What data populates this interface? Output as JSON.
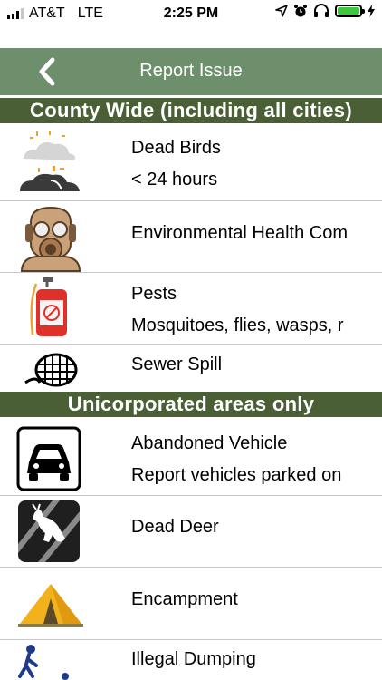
{
  "status_bar": {
    "carrier": "AT&T",
    "network": "LTE",
    "time": "2:25 PM",
    "battery_level": 1.0,
    "icons": [
      "location-icon",
      "alarm-icon",
      "headphones-icon",
      "battery-icon",
      "charging-icon"
    ]
  },
  "nav": {
    "title": "Report Issue",
    "back_icon": "chevron-left-icon",
    "bar_color": "#6e8f6b"
  },
  "sections": [
    {
      "title": "County Wide (including all cities)",
      "items": [
        {
          "title": "Dead Birds",
          "subtitle": "< 24 hours",
          "icon": "dead-birds-icon"
        },
        {
          "title": "Environmental Health Com",
          "subtitle": "",
          "icon": "gas-mask-icon"
        },
        {
          "title": "Pests",
          "subtitle": "Mosquitoes, flies, wasps, r",
          "icon": "sprayer-icon"
        },
        {
          "title": "Sewer Spill",
          "subtitle": "",
          "icon": "sewer-grate-icon"
        }
      ]
    },
    {
      "title": "Unicorporated areas only",
      "items": [
        {
          "title": "Abandoned Vehicle",
          "subtitle": "Report vehicles parked on",
          "icon": "car-icon"
        },
        {
          "title": "Dead Deer",
          "subtitle": "",
          "icon": "deer-crossing-icon"
        },
        {
          "title": "Encampment",
          "subtitle": "",
          "icon": "tent-icon"
        },
        {
          "title": "Illegal Dumping",
          "subtitle": "",
          "icon": "dumping-icon"
        }
      ]
    }
  ],
  "colors": {
    "section_header": "#4a5f35",
    "divider": "#c8c8c8"
  }
}
